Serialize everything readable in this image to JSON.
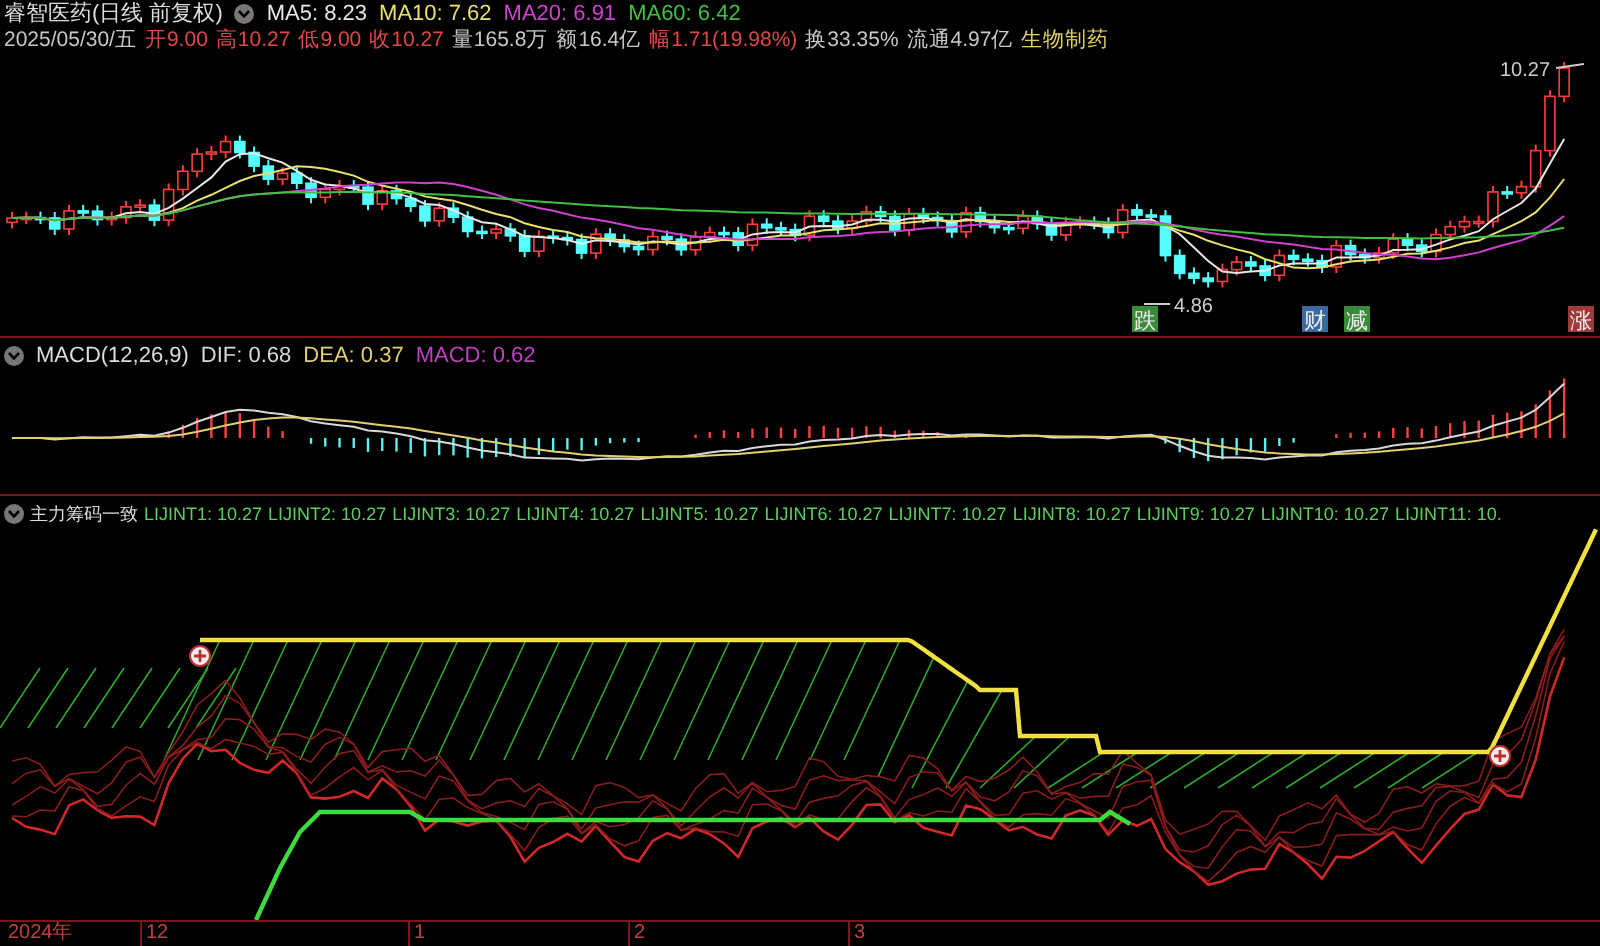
{
  "title": "睿智医药(日线 前复权)",
  "ma": [
    {
      "text": "MA5: 8.23",
      "color": "#e8e8e8"
    },
    {
      "text": "MA10: 7.62",
      "color": "#e8e070"
    },
    {
      "text": "MA20: 6.91",
      "color": "#d040d0"
    },
    {
      "text": "MA60: 6.42",
      "color": "#40c040"
    }
  ],
  "quote": [
    {
      "text": "2025/05/30/五",
      "color": "#c8c8c8"
    },
    {
      "text": "开9.00",
      "color": "#e04848"
    },
    {
      "text": "高10.27",
      "color": "#e04848"
    },
    {
      "text": "低9.00",
      "color": "#e04848"
    },
    {
      "text": "收10.27",
      "color": "#e04848"
    },
    {
      "text": "量165.8万",
      "color": "#c8c8c8"
    },
    {
      "text": "额16.4亿",
      "color": "#c8c8c8"
    },
    {
      "text": "幅1.71(19.98%)",
      "color": "#e04848"
    },
    {
      "text": "换33.35%",
      "color": "#c8c8c8"
    },
    {
      "text": "流通4.97亿",
      "color": "#c8c8c8"
    },
    {
      "text": "生物制药",
      "color": "#e0d060"
    }
  ],
  "price_labels": {
    "high": "10.27",
    "low": "4.86"
  },
  "signals": [
    {
      "text": "跌",
      "color": "#3a8a3a"
    },
    {
      "text": "财",
      "color": "#3a6aa0"
    },
    {
      "text": "减",
      "color": "#3a8a3a"
    },
    {
      "text": "涨",
      "color": "#a03a3a"
    }
  ],
  "macd": {
    "name": "MACD(12,26,9)",
    "values": [
      {
        "text": "DIF: 0.68",
        "color": "#d8d8d8"
      },
      {
        "text": "DEA: 0.37",
        "color": "#e0d070"
      },
      {
        "text": "MACD: 0.62",
        "color": "#c040c0"
      }
    ]
  },
  "chips": {
    "name": "主力筹码一致",
    "values": [
      "LIJINT1: 10.27",
      "LIJINT2: 10.27",
      "LIJINT3: 10.27",
      "LIJINT4: 10.27",
      "LIJINT5: 10.27",
      "LIJINT6: 10.27",
      "LIJINT7: 10.27",
      "LIJINT8: 10.27",
      "LIJINT9: 10.27",
      "LIJINT10: 10.27",
      "LIJINT11: 10."
    ]
  },
  "axis": [
    "2024年",
    "12",
    "1",
    "2",
    "3"
  ]
}
